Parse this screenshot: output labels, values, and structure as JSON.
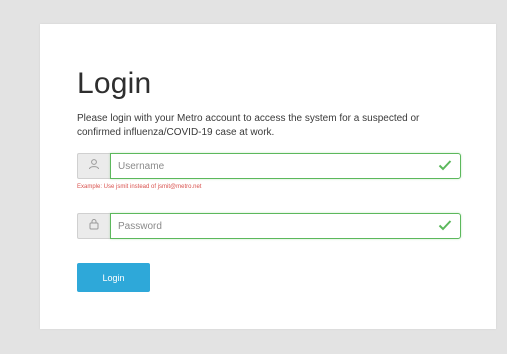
{
  "login": {
    "title": "Login",
    "description": "Please login with your Metro account to access the system for a suspected or confirmed influenza/COVID-19 case at work.",
    "username": {
      "placeholder": "Username",
      "icon": "user-icon",
      "hint": "Example: Use jsmit instead of jsmit@metro.net"
    },
    "password": {
      "placeholder": "Password",
      "icon": "lock-icon"
    },
    "button_label": "Login"
  },
  "colors": {
    "valid_green": "#5cb85c",
    "error_red": "#d9534f",
    "button_blue": "#2ea8d9"
  }
}
